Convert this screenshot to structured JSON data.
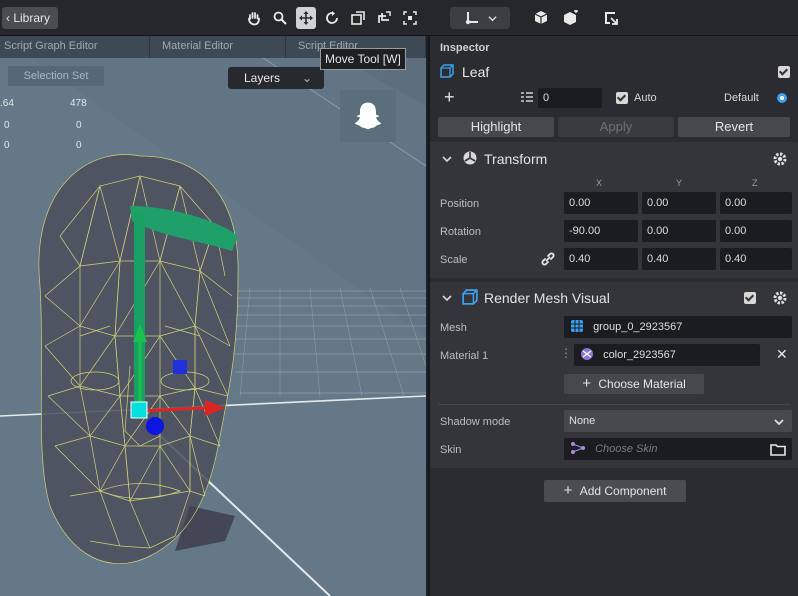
{
  "toolbar": {
    "library_label": "Library",
    "library_prefix": "‹",
    "tools": [
      "hand-tool",
      "zoom-tool",
      "move-tool",
      "rotate-tool",
      "scale-tool",
      "rect-tool",
      "pivot-tool"
    ],
    "active_tool": "move-tool"
  },
  "viewport": {
    "tabs": [
      "Script Graph Editor",
      "Material Editor",
      "Script Editor"
    ],
    "selection_set_label": "Selection Set",
    "layers_label": "Layers",
    "tooltip": "Move Tool [W]",
    "stats": [
      {
        "a": ".64",
        "b": "478"
      },
      {
        "a": "0",
        "b": "0"
      },
      {
        "a": "0",
        "b": "0"
      }
    ]
  },
  "inspector": {
    "title": "Inspector",
    "object_name": "Leaf",
    "layer_value": "0",
    "auto_label": "Auto",
    "default_label": "Default",
    "highlight_label": "Highlight",
    "apply_label": "Apply",
    "revert_label": "Revert",
    "transform": {
      "title": "Transform",
      "axes": [
        "X",
        "Y",
        "Z"
      ],
      "position_label": "Position",
      "rotation_label": "Rotation",
      "scale_label": "Scale",
      "position": [
        "0.00",
        "0.00",
        "0.00"
      ],
      "rotation": [
        "-90.00",
        "0.00",
        "0.00"
      ],
      "scale": [
        "0.40",
        "0.40",
        "0.40"
      ]
    },
    "render_mesh": {
      "title": "Render Mesh Visual",
      "mesh_label": "Mesh",
      "mesh_value": "group_0_2923567",
      "material_label": "Material 1",
      "material_value": "color_2923567",
      "choose_material_label": "Choose Material",
      "shadow_label": "Shadow mode",
      "shadow_value": "None",
      "skin_label": "Skin",
      "skin_placeholder": "Choose Skin"
    },
    "add_component_label": "Add Component"
  },
  "colors": {
    "accent_blue": "#3ba0f0",
    "gizmo_green": "#19b36a",
    "gizmo_red": "#e02424",
    "gizmo_blue": "#1520e0",
    "wire_yellow": "#dede7a"
  }
}
